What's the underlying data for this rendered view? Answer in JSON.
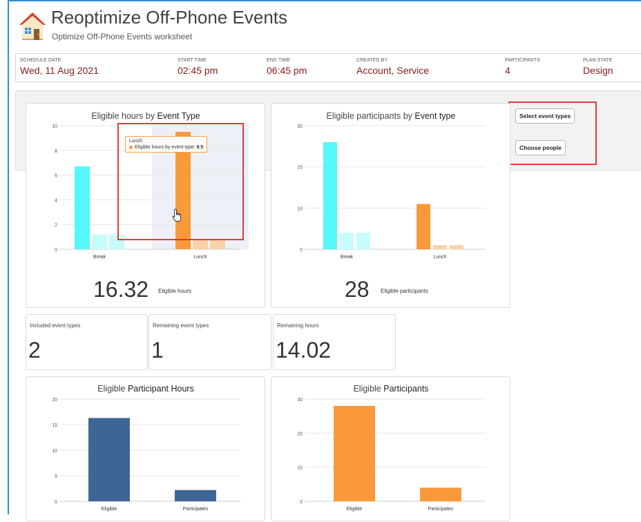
{
  "header": {
    "title": "Reoptimize Off-Phone Events",
    "subtitle": "Optimize Off-Phone Events worksheet",
    "icon": "house-icon"
  },
  "info": [
    {
      "label": "SCHEDULE DATE",
      "value": "Wed, 11 Aug 2021"
    },
    {
      "label": "START TIME",
      "value": "02:45 pm"
    },
    {
      "label": "END TIME",
      "value": "06:45 pm"
    },
    {
      "label": "CREATED BY",
      "value": "Account, Service"
    },
    {
      "label": "PARTICIPANTS",
      "value": "4"
    },
    {
      "label": "PLAN STATE",
      "value": "Design"
    }
  ],
  "buttons": {
    "select_event_types": "Select event types",
    "choose_people": "Choose people"
  },
  "colors": {
    "cyan": "#55f7f9",
    "cyan_light": "#c7fcfd",
    "orange": "#f9993a",
    "orange_light": "#fbd3a8",
    "navy": "#3f6594",
    "accent_red": "#e53935",
    "value_red": "#8b1a1a"
  },
  "summary": {
    "eligible_hours": {
      "value": "16.32",
      "label": "Eligible hours"
    },
    "eligible_participants": {
      "value": "28",
      "label": "Eligible participants"
    }
  },
  "stats": [
    {
      "label": "Included event types",
      "value": "2"
    },
    {
      "label": "Remaining event types",
      "value": "1"
    },
    {
      "label": "Remaining hours",
      "value": "14.02"
    }
  ],
  "tooltip": {
    "category": "Lunch",
    "series": "Eligible hours by event type:",
    "value": "9.5"
  },
  "chart_data": [
    {
      "type": "bar",
      "title_plain": "Eligible hours by ",
      "title_bold": "Event Type",
      "categories": [
        "Break",
        "Lunch"
      ],
      "ylim": [
        0,
        10
      ],
      "yticks": [
        0,
        2,
        4,
        6,
        8,
        10
      ],
      "groups": [
        {
          "category": "Break",
          "bars": [
            {
              "value": 6.7,
              "color": "cyan"
            },
            {
              "value": 1.2,
              "color": "cyan_light"
            },
            {
              "value": 1.2,
              "color": "cyan_light"
            }
          ]
        },
        {
          "category": "Lunch",
          "bars": [
            {
              "value": 9.5,
              "color": "orange"
            },
            {
              "value": 0.8,
              "color": "orange_light"
            },
            {
              "value": 0.8,
              "color": "orange_light"
            }
          ]
        }
      ],
      "highlight": "Lunch"
    },
    {
      "type": "bar",
      "title_plain": "Eligible participants by ",
      "title_bold": "Event type",
      "categories": [
        "Break",
        "Lunch"
      ],
      "ylim": [
        0,
        30
      ],
      "yticks": [
        0,
        10,
        20,
        30
      ],
      "groups": [
        {
          "category": "Break",
          "bars": [
            {
              "value": 26,
              "color": "cyan"
            },
            {
              "value": 4,
              "color": "cyan_light"
            },
            {
              "value": 4,
              "color": "cyan_light"
            }
          ]
        },
        {
          "category": "Lunch",
          "bars": [
            {
              "value": 11,
              "color": "orange"
            },
            {
              "value": 1,
              "color": "orange_light"
            },
            {
              "value": 1,
              "color": "orange_light"
            }
          ]
        }
      ]
    },
    {
      "type": "bar",
      "title_plain": "Eligible ",
      "title_bold": "Participant Hours",
      "categories": [
        "Eligible",
        "Participates"
      ],
      "ylim": [
        0,
        20
      ],
      "yticks": [
        0,
        5,
        10,
        15,
        20
      ],
      "groups": [
        {
          "category": "Eligible",
          "bars": [
            {
              "value": 16.3,
              "color": "navy"
            }
          ]
        },
        {
          "category": "Participates",
          "bars": [
            {
              "value": 2.2,
              "color": "navy"
            }
          ]
        }
      ]
    },
    {
      "type": "bar",
      "title_plain": "Eligible ",
      "title_bold": "Participants",
      "categories": [
        "Eligible",
        "Participates"
      ],
      "ylim": [
        0,
        30
      ],
      "yticks": [
        0,
        10,
        20,
        30
      ],
      "groups": [
        {
          "category": "Eligible",
          "bars": [
            {
              "value": 28,
              "color": "orange"
            }
          ]
        },
        {
          "category": "Participates",
          "bars": [
            {
              "value": 4,
              "color": "orange"
            }
          ]
        }
      ]
    }
  ]
}
